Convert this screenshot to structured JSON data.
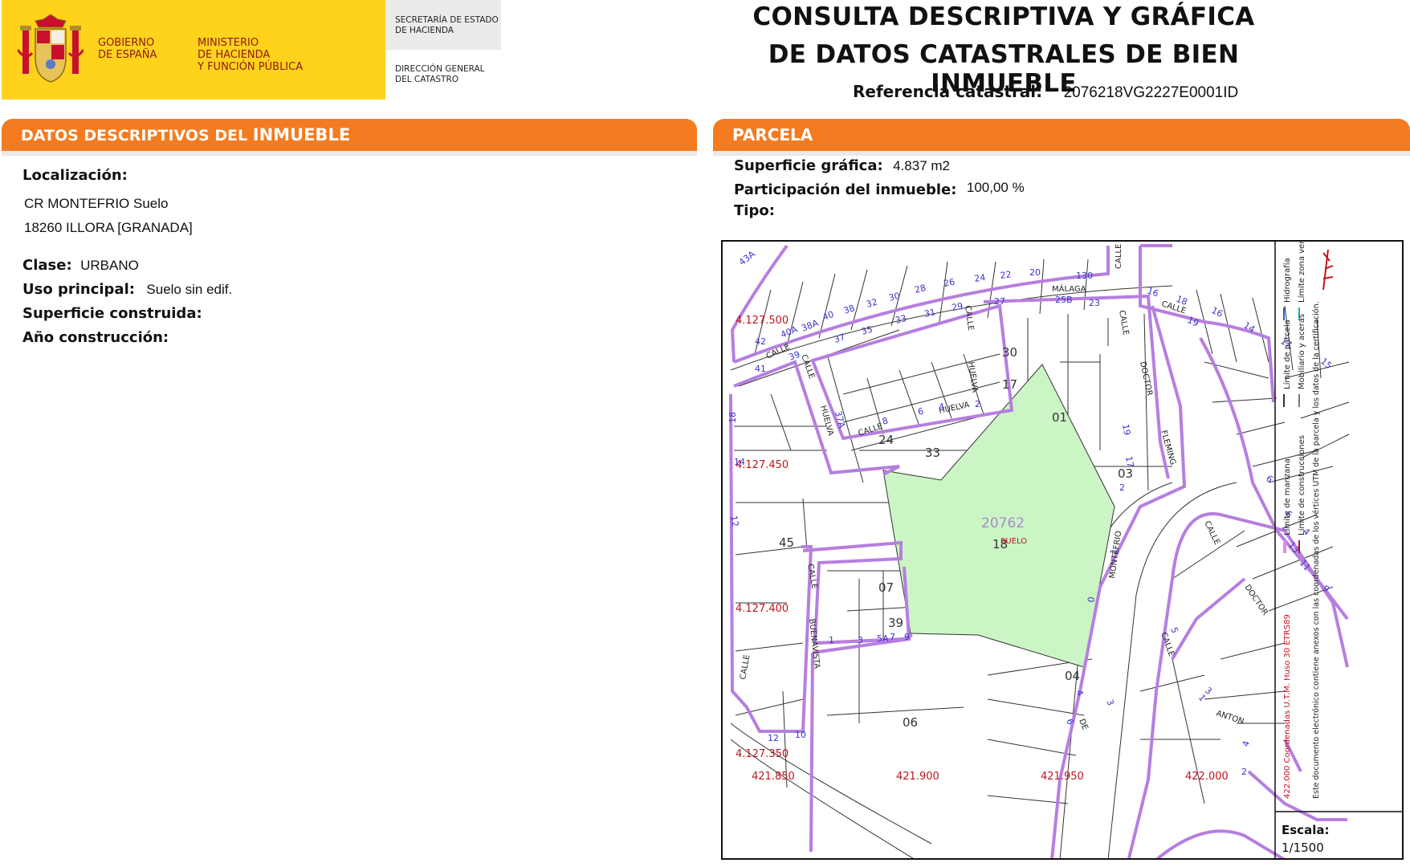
{
  "header": {
    "gobierno": [
      "GOBIERNO",
      "DE ESPAÑA"
    ],
    "ministerio": [
      "MINISTERIO",
      "DE HACIENDA",
      "Y FUNCIÓN PÚBLICA"
    ],
    "secretaria": [
      "SECRETARÍA DE ESTADO",
      "DE HACIENDA"
    ],
    "direccion": [
      "DIRECCIÓN GENERAL",
      "DEL CATASTRO"
    ],
    "title_line1": "CONSULTA DESCRIPTIVA Y GRÁFICA",
    "title_line2": "DE DATOS CATASTRALES DE BIEN INMUEBLE",
    "refcat_label": "Referencia catastral:",
    "refcat_value": "2076218VG2227E0001ID"
  },
  "descriptivos": {
    "heading_prefix": "DATOS DESCRIPTIVOS DEL ",
    "heading_bold": "INMUEBLE",
    "localizacion_label": "Localización:",
    "localizacion_line1": "CR MONTEFRIO  Suelo",
    "localizacion_line2": "18260 ILLORA [GRANADA]",
    "clase_label": "Clase:",
    "clase_value": "URBANO",
    "uso_label": "Uso principal:",
    "uso_value": "Suelo sin edif.",
    "superficie_label": "Superficie construida:",
    "anio_label": "Año construcción:"
  },
  "parcela": {
    "heading": "PARCELA",
    "superficie_label": "Superficie gráfica:",
    "superficie_value": "4.837 m2",
    "participacion_label": "Participación del inmueble:",
    "participacion_value": "100,00 %",
    "tipo_label": "Tipo:"
  },
  "map": {
    "parcel_number": "20762",
    "parcel_sub": "18",
    "parcel_use": "SUELO",
    "y_coords": [
      "4.127.500",
      "4.127.450",
      "4.127.400",
      "4.127.350"
    ],
    "x_coords": [
      "421.850",
      "421.900",
      "421.950",
      "422.000"
    ],
    "block_labels": [
      "30",
      "17",
      "01",
      "33",
      "24",
      "03",
      "45",
      "07",
      "39",
      "04",
      "06"
    ],
    "street_labels": [
      "CALLE",
      "MÁLAGA",
      "HUELVA",
      "DOCTOR",
      "FLEMING",
      "MONTEFRIO",
      "BUENAVISTA",
      "ANTON",
      "DE"
    ],
    "house_numbers": [
      "43A",
      "43",
      "42",
      "41",
      "40A",
      "38A",
      "40",
      "38",
      "32",
      "30",
      "28",
      "26",
      "24",
      "22",
      "20",
      "130",
      "27",
      "25B",
      "23",
      "16",
      "18",
      "16",
      "14",
      "15",
      "19",
      "17",
      "21",
      "37",
      "35",
      "33",
      "31",
      "29",
      "39",
      "37A",
      "8",
      "6",
      "4",
      "2",
      "18",
      "14",
      "12",
      "2",
      "1",
      "3",
      "5A",
      "7",
      "9",
      "12",
      "10",
      "14",
      "12",
      "19",
      "17",
      "2",
      "6",
      "4",
      "13",
      "11",
      "9",
      "0",
      "1",
      "4",
      "6",
      "3",
      "5",
      "1",
      "3",
      "4",
      "2"
    ],
    "legend": {
      "manzana": "Límite de manzana",
      "parcela": "Límite de parcela",
      "hidrografia": "Hidrografía",
      "construcciones": "Límite de construcciones",
      "mobiliario": "Mobiliario y aceras",
      "zona_verde": "Límite zona verde",
      "coords": "422.000 Coordenadas U.T.M. Huso 30 ETRS89",
      "note": "Este documento electrónico contiene anexos con las coordenadas de los vértices UTM de la parcela y los datos de la certificación."
    },
    "escala_label": "Escala:",
    "escala_value": "1/1500"
  },
  "colors": {
    "orange": "#f47b20",
    "yellow": "#ffd21c",
    "parcel_fill": "#ccf5c6",
    "block_outline": "#b77ee0",
    "coord_red": "#c0141b"
  }
}
